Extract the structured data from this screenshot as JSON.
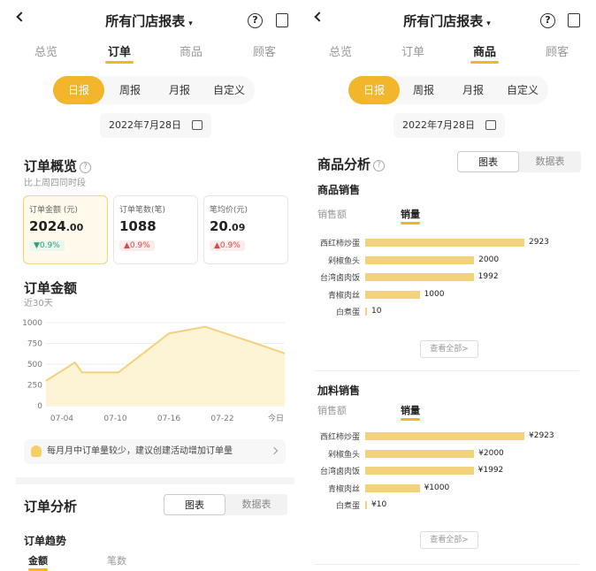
{
  "header": {
    "title": "所有门店报表",
    "caret": "▾"
  },
  "icons": {
    "help": "?",
    "calendar": "▦"
  },
  "tabs": [
    "总览",
    "订单",
    "商品",
    "顾客"
  ],
  "periods": [
    "日报",
    "周报",
    "月报",
    "自定义"
  ],
  "date": "2022年7月28日",
  "left": {
    "active_tab": "订单",
    "overview": {
      "title": "订单概览",
      "subtitle": "比上周四同时段",
      "kpis": [
        {
          "label": "订单金额 (元)",
          "value_main": "2024",
          "value_dec": ".00",
          "change": "▼0.9%",
          "direction": "down"
        },
        {
          "label": "订单笔数(笔)",
          "value_main": "1088",
          "value_dec": "",
          "change": "▲0.9%",
          "direction": "up"
        },
        {
          "label": "笔均价(元)",
          "value_main": "20",
          "value_dec": ".09",
          "change": "▲0.9%",
          "direction": "up"
        }
      ]
    },
    "amount": {
      "title": "订单金额",
      "subtitle": "近30天"
    },
    "tip": "每月月中订单量较少，建议创建活动增加订单量",
    "analysis": {
      "title": "订单分析",
      "toggle": [
        "图表",
        "数据表"
      ],
      "trend_title": "订单趋势",
      "subtabs": [
        "金额",
        "笔数"
      ]
    }
  },
  "right": {
    "active_tab": "商品",
    "analysis_title": "商品分析",
    "toggle": [
      "图表",
      "数据表"
    ],
    "sales": {
      "title": "商品销售",
      "subtabs": [
        "销售额",
        "销量"
      ],
      "more": "查看全部>"
    },
    "addon": {
      "title": "加料销售",
      "subtabs": [
        "销售额",
        "销量"
      ],
      "more": "查看全部>"
    }
  },
  "chart_data": [
    {
      "type": "area",
      "title": "订单金额",
      "subtitle": "近30天",
      "x_ticks": [
        "07-04",
        "07-10",
        "07-16",
        "07-22",
        "今日"
      ],
      "y_ticks": [
        0,
        250,
        500,
        750,
        1000
      ],
      "ylim": [
        0,
        1000
      ],
      "x": [
        0,
        4,
        5,
        10,
        17,
        22,
        29,
        33
      ],
      "y": [
        300,
        520,
        400,
        400,
        870,
        950,
        750,
        630
      ],
      "color": "#f2d27c",
      "fill": "#fdf4d6"
    },
    {
      "type": "bar",
      "orientation": "horizontal",
      "title": "商品销售",
      "categories": [
        "西红柿炒蛋",
        "剁椒鱼头",
        "台湾卤肉饭",
        "青椒肉丝",
        "白煮蛋"
      ],
      "values": [
        2923,
        2000,
        1992,
        1000,
        10
      ],
      "value_prefix": "",
      "color": "#f2d27c"
    },
    {
      "type": "bar",
      "orientation": "horizontal",
      "title": "加料销售",
      "categories": [
        "西红柿炒蛋",
        "剁椒鱼头",
        "台湾卤肉饭",
        "青椒肉丝",
        "白煮蛋"
      ],
      "values": [
        2923,
        2000,
        1992,
        1000,
        10
      ],
      "value_prefix": "¥",
      "color": "#f2d27c"
    }
  ]
}
